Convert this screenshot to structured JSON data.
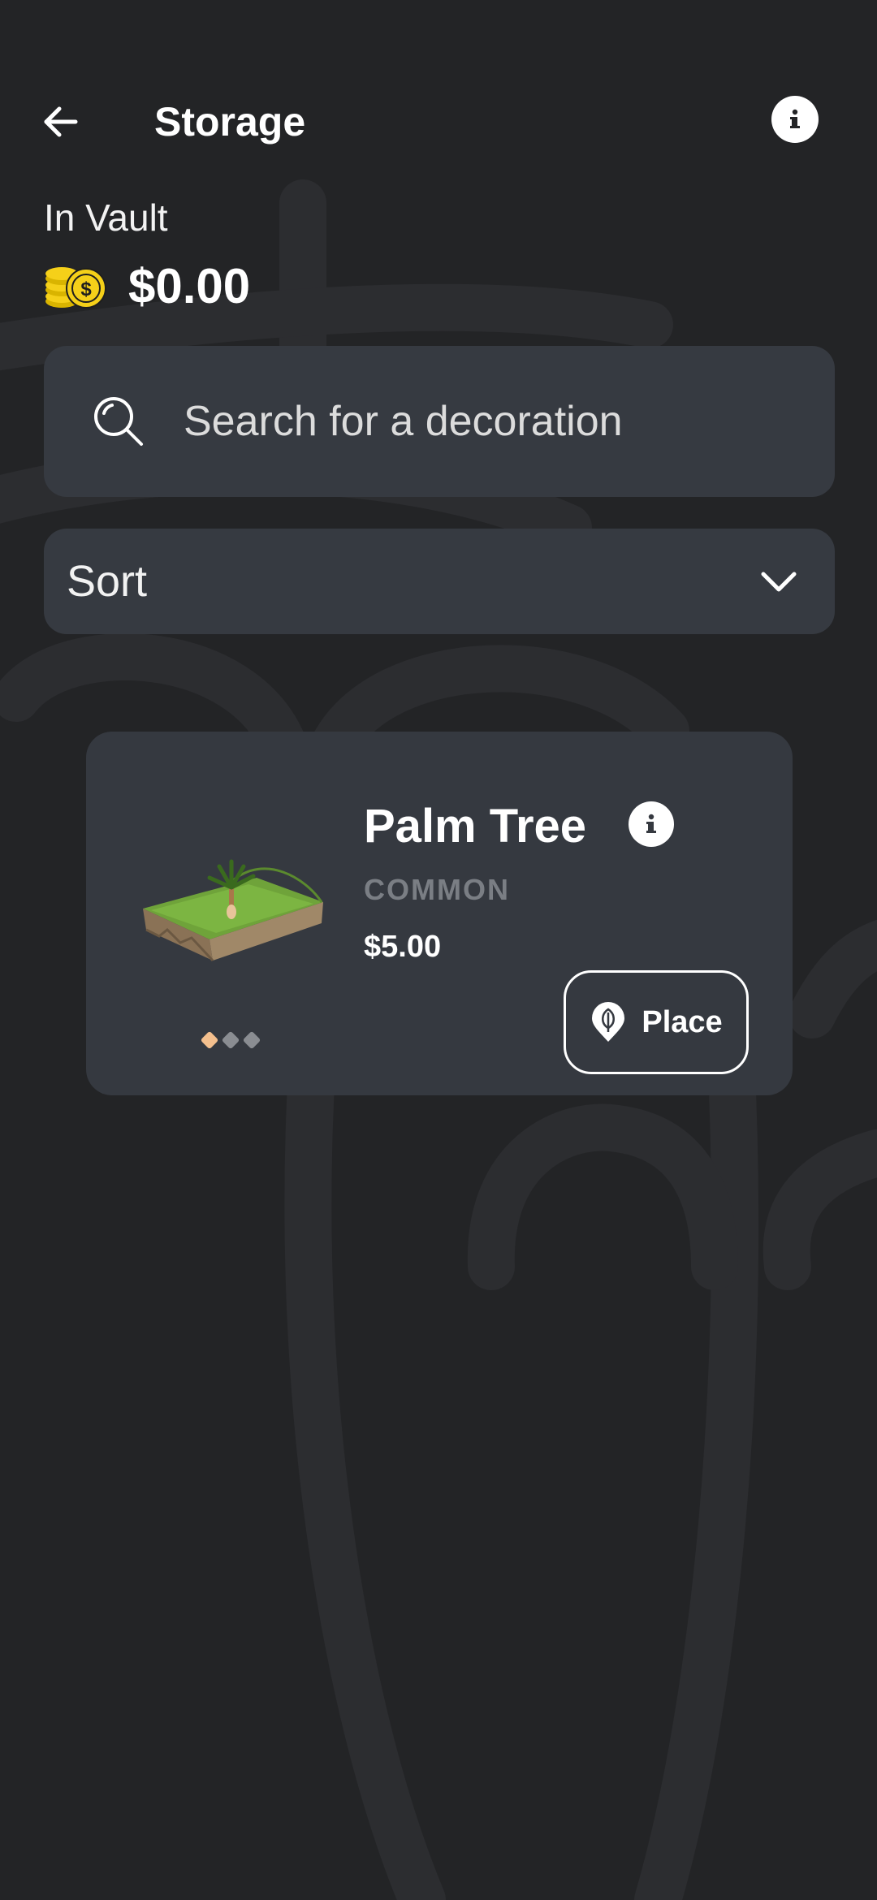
{
  "header": {
    "title": "Storage",
    "back_icon": "arrow-left-icon",
    "info_icon": "info-icon"
  },
  "vault": {
    "label": "In Vault",
    "value": "$0.00",
    "icon": "coins-icon"
  },
  "search": {
    "placeholder": "Search for a decoration",
    "value": "",
    "icon": "search-icon"
  },
  "sort": {
    "label": "Sort",
    "icon": "chevron-down-icon"
  },
  "items": [
    {
      "name": "Palm Tree",
      "rarity": "COMMON",
      "price": "$5.00",
      "action_label": "Place",
      "action_icon": "location-pin-leaf-icon",
      "image_pages": 3,
      "active_image_page": 1
    }
  ],
  "colors": {
    "background": "#232426",
    "surface": "#363a41",
    "card": "#353940",
    "muted_text": "#7a7e84",
    "coin": "#f5d019",
    "active_dot": "#f4c08e",
    "inactive_dot": "#8a8d92"
  }
}
